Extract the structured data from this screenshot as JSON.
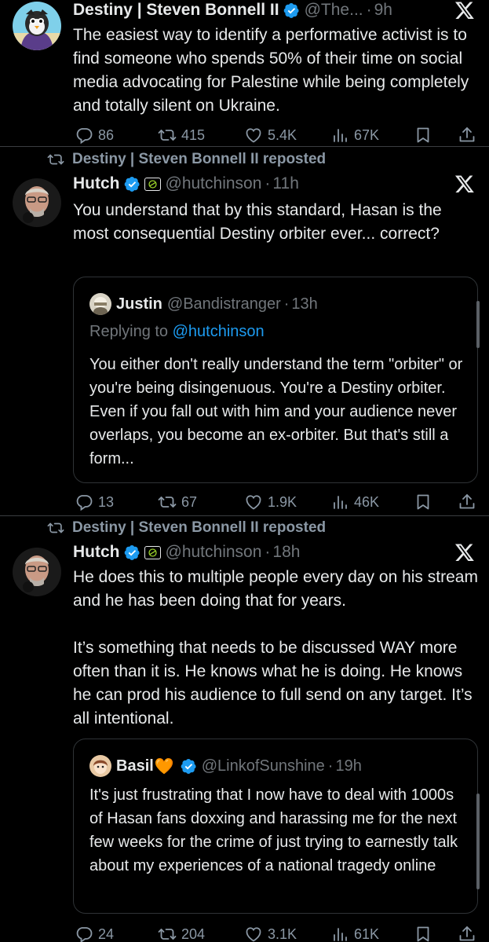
{
  "tweets": [
    {
      "name": "Destiny | Steven Bonnell II",
      "handle": "@The...",
      "time": "9h",
      "text": "The easiest way to identify a performative activist is to find someone who spends 50% of their time on social media advocating for Palestine while being completely and totally silent on Ukraine.",
      "stats": {
        "replies": "86",
        "reposts": "415",
        "likes": "5.4K",
        "views": "67K"
      }
    },
    {
      "repost_label": "Destiny | Steven Bonnell II reposted",
      "name": "Hutch",
      "handle": "@hutchinson",
      "time": "11h",
      "text": "You understand that by this standard, Hasan is the most consequential Destiny orbiter ever... correct?",
      "quote": {
        "name": "Justin",
        "handle": "@Bandistranger",
        "time": "13h",
        "reply_prefix": "Replying to ",
        "reply_mention": "@hutchinson",
        "text": "You either don't really understand the term \"orbiter\" or you're being disingenuous. You're a Destiny orbiter. Even if you fall out with him and your audience never overlaps, you become an ex-orbiter. But that's still a form..."
      },
      "stats": {
        "replies": "13",
        "reposts": "67",
        "likes": "1.9K",
        "views": "46K"
      }
    },
    {
      "repost_label": "Destiny | Steven Bonnell II reposted",
      "name": "Hutch",
      "handle": "@hutchinson",
      "time": "18h",
      "text": "He does this to multiple people every day on his stream and he has been doing that for years.\n\nIt’s something that needs to be discussed WAY more often than it is. He knows what he is doing. He knows he can prod his audience to full send on any target. It’s all intentional.",
      "quote": {
        "name": "Basil",
        "name_emoji": "🧡",
        "handle": "@LinkofSunshine",
        "time": "19h",
        "text": "It's just frustrating that I now have to deal with 1000s of Hasan fans doxxing and harassing me for the next few weeks for the crime of just trying to earnestly talk about my experiences of a national tragedy online"
      },
      "stats": {
        "replies": "24",
        "reposts": "204",
        "likes": "3.1K",
        "views": "61K"
      }
    }
  ],
  "separator": "·",
  "icons": {
    "verified": "verified-badge-icon",
    "affiliate": "affiliate-badge-icon",
    "x_logo": "x-logo-icon",
    "reply": "reply-icon",
    "repost": "repost-icon",
    "like": "like-icon",
    "views": "views-icon",
    "bookmark": "bookmark-icon",
    "share": "share-icon"
  },
  "colors": {
    "background": "#000000",
    "text": "#e7e9ea",
    "muted": "#71767b",
    "link": "#1d9bf0",
    "verified": "#1d9bf0",
    "heart_emoji": "#f58b1f"
  }
}
